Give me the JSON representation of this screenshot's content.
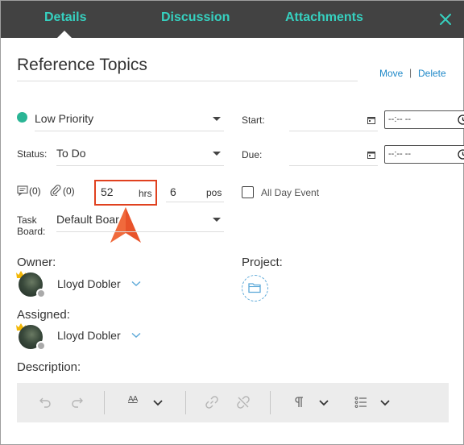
{
  "tabs": [
    {
      "label": "Details"
    },
    {
      "label": "Discussion"
    },
    {
      "label": "Attachments"
    }
  ],
  "task": {
    "title": "Reference Topics",
    "move_label": "Move",
    "separator": "|",
    "delete_label": "Delete"
  },
  "fields": {
    "priority": "Low Priority",
    "status_label": "Status:",
    "status_value": "To Do",
    "start_label": "Start:",
    "due_label": "Due:",
    "time_placeholder": "--:-- --",
    "discussion_count": "(0)",
    "attachment_count": "(0)",
    "hours_value": "52",
    "hours_unit": "hrs",
    "points_value": "6",
    "points_unit": "pos",
    "all_day_label": "All Day Event",
    "task_board_label_1": "Task",
    "task_board_label_2": "Board:",
    "task_board_value": "Default Boar"
  },
  "people": {
    "owner_label": "Owner:",
    "owner_name": "Lloyd Dobler",
    "project_label": "Project:",
    "assigned_label": "Assigned:",
    "assigned_name": "Lloyd Dobler"
  },
  "description": {
    "label": "Description:",
    "font_size_glyph": "AA"
  },
  "colors": {
    "tab_bar": "#424242",
    "tab_text": "#36d1c0",
    "priority_dot": "#2ab595",
    "link": "#1e88c8",
    "highlight": "#e0411f"
  }
}
